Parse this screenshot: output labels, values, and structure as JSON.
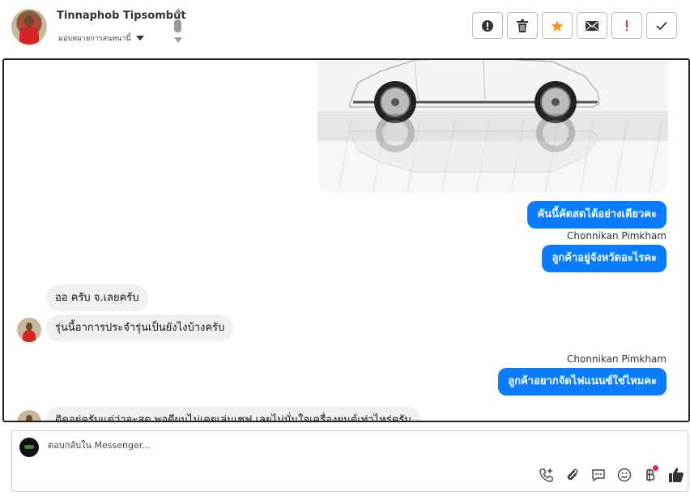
{
  "header": {
    "contact_name": "Tinnaphob Tipsombut",
    "assign_label": "มอบหมายการสนทนานี้",
    "toolbar": [
      {
        "name": "spam-button",
        "icon": "alert-circle-icon"
      },
      {
        "name": "delete-button",
        "icon": "trash-icon"
      },
      {
        "name": "star-button",
        "icon": "star-icon",
        "color": "#f7931e"
      },
      {
        "name": "mark-unread-button",
        "icon": "envelope-icon"
      },
      {
        "name": "important-button",
        "icon": "exclamation-icon",
        "color": "#e0245e"
      },
      {
        "name": "done-button",
        "icon": "checkmark-icon"
      }
    ]
  },
  "conversation": {
    "messages": [
      {
        "direction": "out",
        "text": "คันนี้คัดสดได้อย่างเดียวคะ"
      },
      {
        "direction": "out",
        "sender": "Chonnikan Pimkham",
        "text": "ลูกค้าอยู่จังหวัดอะไรคะ"
      },
      {
        "direction": "in",
        "text": "ออ ครับ จ.เลยครับ"
      },
      {
        "direction": "in",
        "text": "รุ่นนี้อาการประจำรุ่นเป็นยังไงบ้างครับ"
      },
      {
        "direction": "out",
        "sender": "Chonnikan Pimkham",
        "text": "ลูกค้าอยากจัดไฟแนนซ์ใช่ไหมคะ"
      },
      {
        "direction": "in",
        "text": "ติดอยู่ครับแต่ว่าจะสด พอดีผมไม่เคยเล่นเชฟ เลยไม่มั่นใจเครื่องยนต์เท่าไหร่ครับ"
      }
    ]
  },
  "reply": {
    "placeholder": "ตอบกลับใน Messenger..."
  },
  "colors": {
    "accent": "#0a7cff",
    "incoming_bubble": "#f0f0f0"
  }
}
